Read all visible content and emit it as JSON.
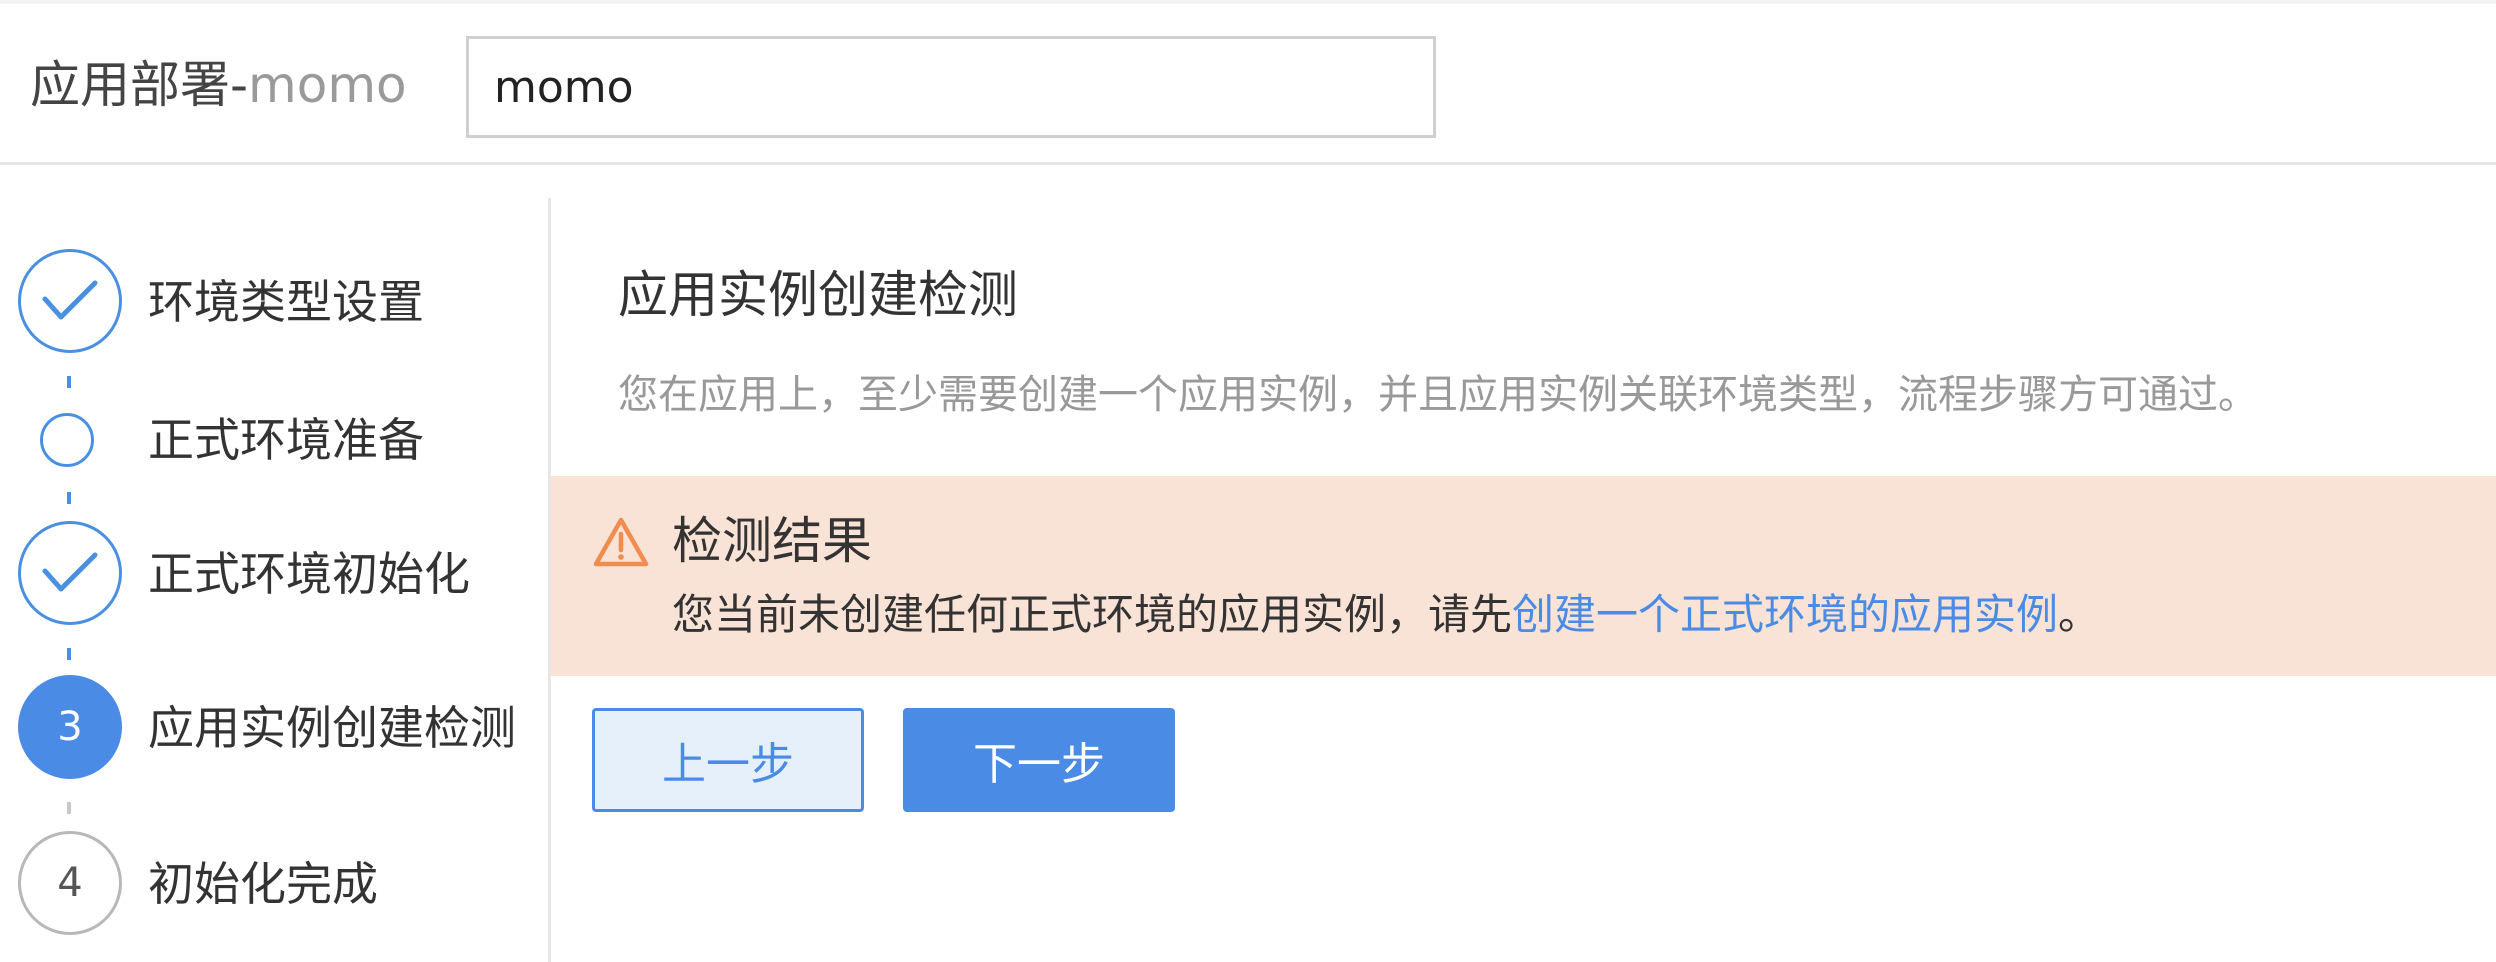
{
  "header": {
    "title": "应用部署-",
    "app_name": "momo",
    "input_value": "momo"
  },
  "steps": [
    {
      "label": "环境类型设置",
      "state": "done",
      "number": ""
    },
    {
      "label": "正式环境准备",
      "state": "pending",
      "number": ""
    },
    {
      "label": "正式环境初始化",
      "state": "done",
      "number": ""
    },
    {
      "label": "应用实例创建检测",
      "state": "active",
      "number": "3"
    },
    {
      "label": "初始化完成",
      "state": "todo",
      "number": "4"
    }
  ],
  "main": {
    "title": "应用实例创建检测",
    "description": "您在应用上，至少需要创建一个应用实例，并且应用实例关联环境类型，流程步骤方可通过。"
  },
  "alert": {
    "icon": "warning-icon",
    "title": "检测结果",
    "message_prefix": "您当前未创建任何正式环境的应用实例，请先",
    "link_text": "创建一个正式环境的应用实例",
    "message_suffix": "。"
  },
  "buttons": {
    "prev_label": "上一步",
    "next_label": "下一步"
  },
  "colors": {
    "accent": "#4a8be6",
    "alert_bg": "#f9e2d6",
    "warning": "#f08c4e"
  }
}
